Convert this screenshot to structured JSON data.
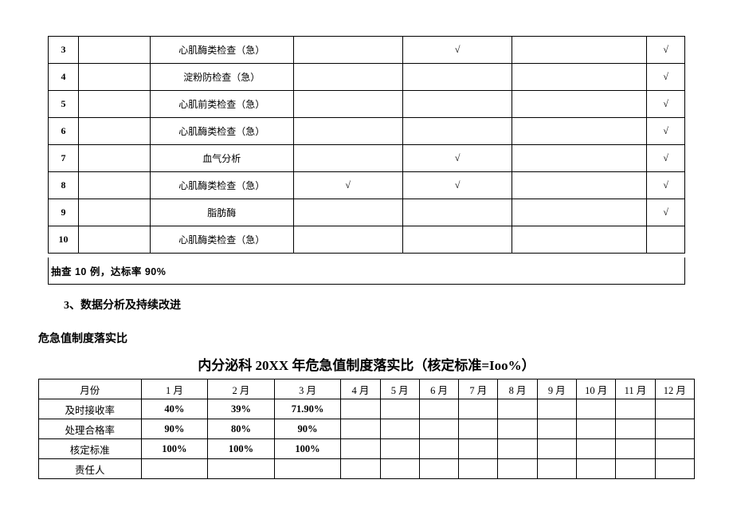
{
  "table1": {
    "rows": [
      {
        "n": "3",
        "item": "心肌酶类检查（急）",
        "a": "",
        "b": "√",
        "c": "",
        "d": "√"
      },
      {
        "n": "4",
        "item": "淀粉防检查（急）",
        "a": "",
        "b": "",
        "c": "",
        "d": "√"
      },
      {
        "n": "5",
        "item": "心肌前类检查（急）",
        "a": "",
        "b": "",
        "c": "",
        "d": "√"
      },
      {
        "n": "6",
        "item": "心肌酶类检查（急）",
        "a": "",
        "b": "",
        "c": "",
        "d": "√"
      },
      {
        "n": "7",
        "item": "血气分析",
        "a": "",
        "b": "√",
        "c": "",
        "d": "√"
      },
      {
        "n": "8",
        "item": "心肌酶类检查（急）",
        "a": "√",
        "b": "√",
        "c": "",
        "d": "√"
      },
      {
        "n": "9",
        "item": "脂肪酶",
        "a": "",
        "b": "",
        "c": "",
        "d": "√"
      },
      {
        "n": "10",
        "item": "心肌酶类检查（急）",
        "a": "",
        "b": "",
        "c": "",
        "d": ""
      }
    ],
    "footer": "抽查 10 例，达标率 90%"
  },
  "section": "3、数据分析及持续改进",
  "subtitle": "危急值制度落实比",
  "title2": "内分泌科 20XX 年危急值制度落实比（核定标准=Ioo%）",
  "table2": {
    "header": [
      "月份",
      "1 月",
      "2 月",
      "3 月",
      "4 月",
      "5 月",
      "6 月",
      "7 月",
      "8 月",
      "9 月",
      "10 月",
      "11 月",
      "12 月"
    ],
    "rows": [
      {
        "label": "及时接收率",
        "v": [
          "40%",
          "39%",
          "71.90%",
          "",
          "",
          "",
          "",
          "",
          "",
          "",
          "",
          ""
        ]
      },
      {
        "label": "处理合格率",
        "v": [
          "90%",
          "80%",
          "90%",
          "",
          "",
          "",
          "",
          "",
          "",
          "",
          "",
          ""
        ]
      },
      {
        "label": "核定标准",
        "v": [
          "100%",
          "100%",
          "100%",
          "",
          "",
          "",
          "",
          "",
          "",
          "",
          "",
          ""
        ]
      },
      {
        "label": "责任人",
        "v": [
          "",
          "",
          "",
          "",
          "",
          "",
          "",
          "",
          "",
          "",
          "",
          ""
        ]
      }
    ]
  }
}
